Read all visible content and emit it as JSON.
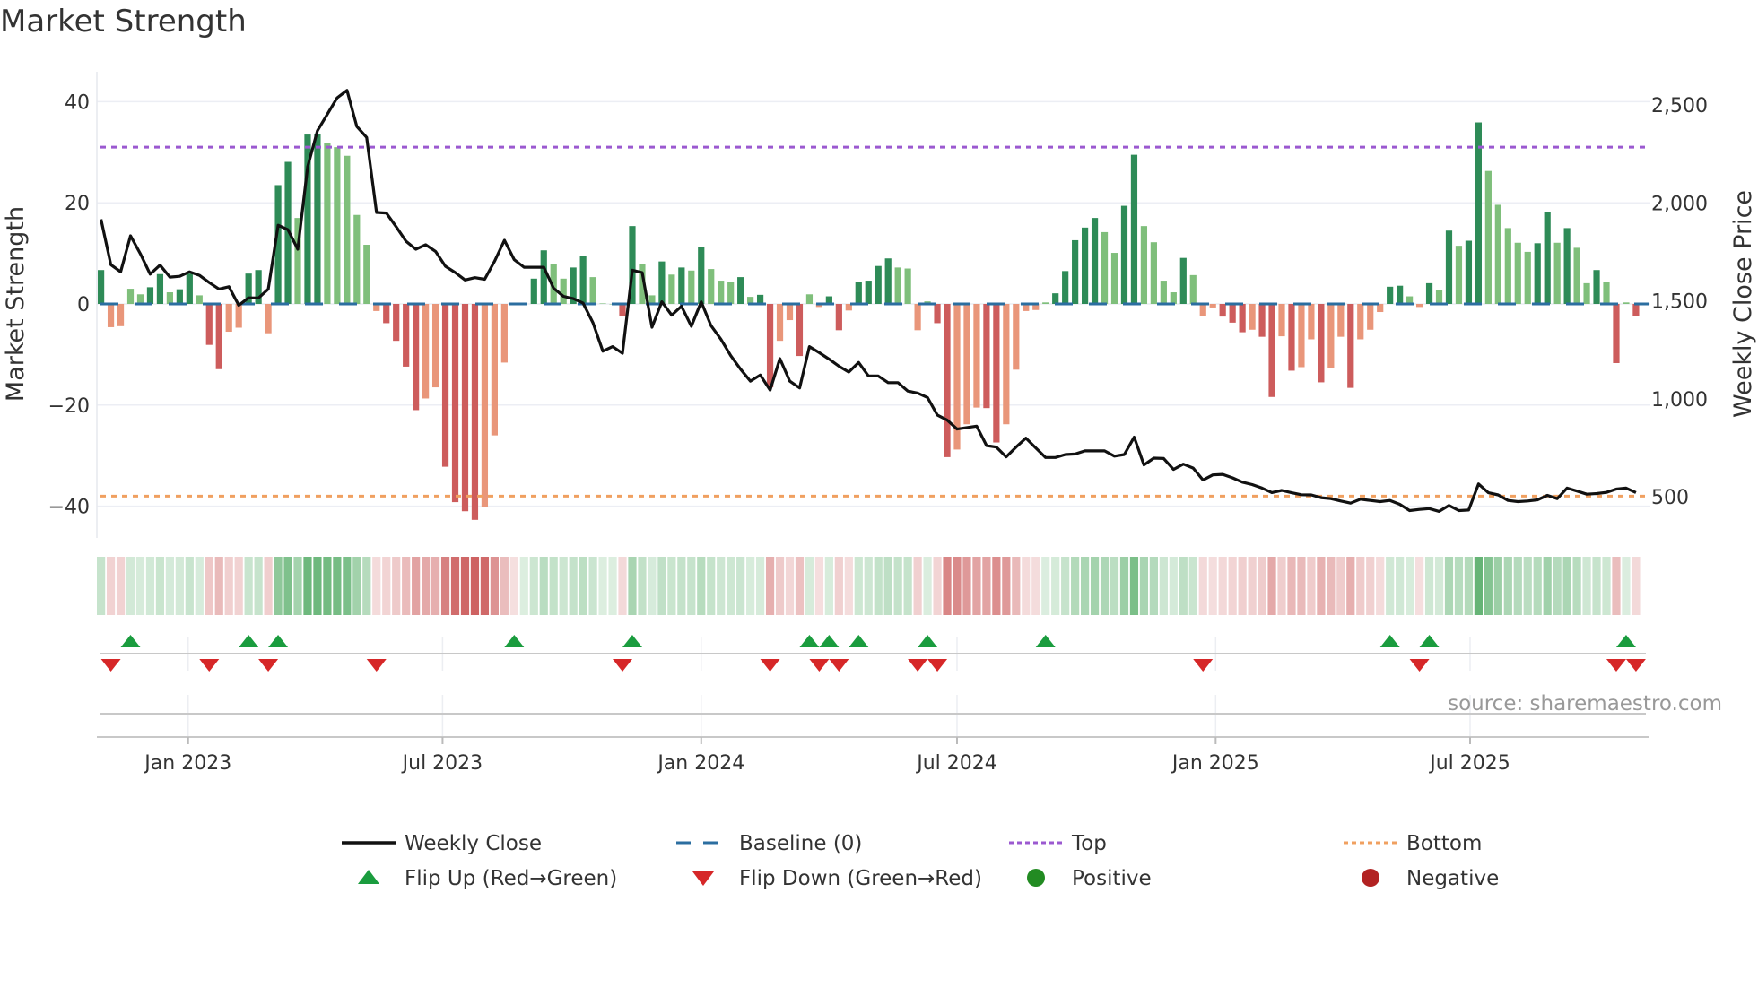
{
  "title": "Market Strength",
  "source_note": "source: sharemaestro.com",
  "colors": {
    "up_strong": "#2e8b57",
    "up_weak": "#7fbf7b",
    "down_strong": "#cd5c5c",
    "down_weak": "#e9967a",
    "price": "#111111",
    "baseline": "#2b6ea0",
    "top": "#9b59d0",
    "bottom": "#f0a060",
    "flip_up": "#1a9c3e",
    "flip_down": "#d62728",
    "positive": "#228b22",
    "negative": "#b22222"
  },
  "chart_data": {
    "type": "bar+line",
    "title": "Market Strength",
    "start_week": "2022-10-31",
    "interval_days": 7,
    "ylabel": "Market Strength",
    "y2label": "Weekly Close Price",
    "ylim": [
      -45,
      45
    ],
    "y2lim": [
      360,
      2600
    ],
    "yticks": [
      {
        "v": 40,
        "label": "40"
      },
      {
        "v": 20,
        "label": "20"
      },
      {
        "v": 0,
        "label": "0"
      },
      {
        "v": -20,
        "label": "−20"
      },
      {
        "v": -40,
        "label": "−40"
      }
    ],
    "y2ticks": [
      {
        "v": 2500,
        "label": "2,500"
      },
      {
        "v": 2000,
        "label": "2,000"
      },
      {
        "v": 1500,
        "label": "1,500"
      },
      {
        "v": 1000,
        "label": "1,000"
      },
      {
        "v": 500,
        "label": "500"
      }
    ],
    "xticks": [
      {
        "date": "2023-01-01",
        "label": "Jan 2023"
      },
      {
        "date": "2023-07-01",
        "label": "Jul 2023"
      },
      {
        "date": "2024-01-01",
        "label": "Jan 2024"
      },
      {
        "date": "2024-07-01",
        "label": "Jul 2024"
      },
      {
        "date": "2025-01-01",
        "label": "Jan 2025"
      },
      {
        "date": "2025-07-01",
        "label": "Jul 2025"
      }
    ],
    "top_level": 31,
    "bottom_level": -38,
    "baseline": 0,
    "strength": [
      6.7,
      -4.6,
      -4.4,
      3,
      1.9,
      3.3,
      5.9,
      2.3,
      2.9,
      6,
      1.7,
      -8.1,
      -12.9,
      -5.5,
      -4.7,
      6,
      6.7,
      -5.8,
      23.5,
      28.1,
      17,
      33.5,
      33.6,
      31.9,
      31,
      29.3,
      17.6,
      11.7,
      -1.4,
      -3.8,
      -7.3,
      -12.4,
      -21,
      -18.7,
      -16.5,
      -32.2,
      -39.2,
      -41,
      -42.7,
      -40.2,
      -26,
      -11.6,
      -0.2,
      0.1,
      5,
      10.6,
      7.8,
      5,
      7.2,
      9.5,
      5.3,
      0.1,
      0,
      -2.4,
      15.4,
      7.9,
      1.7,
      8.4,
      5.8,
      7.2,
      6.6,
      11.3,
      6.9,
      4.6,
      4.4,
      5.3,
      1.4,
      1.8,
      -16.5,
      -7.3,
      -3.2,
      -10.3,
      1.9,
      -0.6,
      1.5,
      -5.2,
      -1.3,
      4.4,
      4.6,
      7.5,
      9,
      7.2,
      7,
      -5.2,
      0.5,
      -3.8,
      -30.3,
      -28.8,
      -23.8,
      -20.5,
      -20.6,
      -27.4,
      -23.8,
      -13,
      -1.4,
      -1.2,
      0.3,
      2.1,
      6.5,
      12.6,
      15.1,
      17,
      14.2,
      10.1,
      19.4,
      29.5,
      15.4,
      12.2,
      4.6,
      2.3,
      9.1,
      5.7,
      -2.4,
      -0.7,
      -2.5,
      -3.7,
      -5.6,
      -5.1,
      -6.5,
      -18.4,
      -6.4,
      -13.2,
      -12.5,
      -7,
      -15.5,
      -12.6,
      -6.5,
      -16.6,
      -7,
      -5.1,
      -1.6,
      3.4,
      3.6,
      1.5,
      -0.6,
      4.1,
      2.8,
      14.5,
      11.5,
      12.5,
      35.9,
      26.3,
      19.6,
      15,
      12.1,
      10.3,
      12,
      18.2,
      12.1,
      15,
      11.1,
      4.1,
      6.7,
      4.4,
      -11.7,
      0.3,
      -2.4
    ],
    "weekly_close": [
      1916,
      1684,
      1648,
      1832,
      1740,
      1636,
      1682,
      1621,
      1625,
      1648,
      1630,
      1593,
      1560,
      1572,
      1477,
      1515,
      1514,
      1560,
      1886,
      1863,
      1763,
      2184,
      2368,
      2452,
      2536,
      2574,
      2390,
      2334,
      1951,
      1948,
      1878,
      1804,
      1763,
      1786,
      1752,
      1676,
      1644,
      1606,
      1618,
      1610,
      1702,
      1809,
      1710,
      1671,
      1671,
      1671,
      1564,
      1523,
      1511,
      1488,
      1388,
      1243,
      1266,
      1232,
      1656,
      1644,
      1365,
      1495,
      1427,
      1472,
      1370,
      1495,
      1373,
      1304,
      1220,
      1151,
      1090,
      1121,
      1044,
      1205,
      1090,
      1055,
      1266,
      1235,
      1202,
      1166,
      1136,
      1185,
      1116,
      1116,
      1082,
      1082,
      1039,
      1029,
      1006,
      917,
      891,
      845,
      853,
      860,
      761,
      753,
      703,
      753,
      799,
      749,
      700,
      700,
      715,
      718,
      734,
      734,
      734,
      707,
      715,
      804,
      662,
      697,
      695,
      639,
      666,
      646,
      585,
      611,
      614,
      596,
      574,
      562,
      544,
      521,
      532,
      520,
      510,
      509,
      495,
      490,
      478,
      467,
      487,
      481,
      475,
      481,
      461,
      429,
      435,
      439,
      425,
      455,
      429,
      432,
      565,
      520,
      509,
      481,
      475,
      478,
      484,
      507,
      490,
      544,
      529,
      513,
      516,
      522,
      539,
      544,
      521
    ],
    "flip_up_weeks": [
      3,
      15,
      18,
      42,
      54,
      72,
      74,
      77,
      84,
      96,
      131,
      135,
      155
    ],
    "flip_down_weeks": [
      1,
      11,
      17,
      28,
      53,
      68,
      73,
      75,
      83,
      85,
      112,
      134,
      154,
      156
    ],
    "legend": [
      {
        "key": "weekly_close",
        "label": "Weekly Close"
      },
      {
        "key": "baseline",
        "label": "Baseline (0)"
      },
      {
        "key": "top",
        "label": "Top"
      },
      {
        "key": "bottom",
        "label": "Bottom"
      },
      {
        "key": "flip_up",
        "label": "Flip Up (Red→Green)"
      },
      {
        "key": "flip_down",
        "label": "Flip Down (Green→Red)"
      },
      {
        "key": "positive",
        "label": "Positive"
      },
      {
        "key": "negative",
        "label": "Negative"
      }
    ],
    "legend_placement": "bottom"
  }
}
